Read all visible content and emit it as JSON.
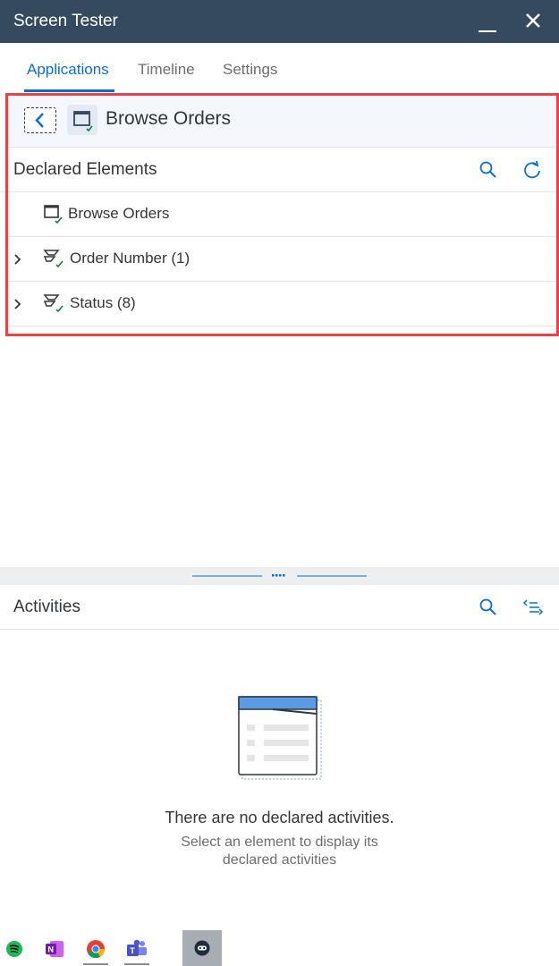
{
  "window": {
    "title": "Screen Tester"
  },
  "tabs": [
    {
      "label": "Applications",
      "active": true
    },
    {
      "label": "Timeline",
      "active": false
    },
    {
      "label": "Settings",
      "active": false
    }
  ],
  "screen": {
    "title": "Browse Orders"
  },
  "declared": {
    "header": "Declared Elements",
    "items": [
      {
        "label": "Browse Orders",
        "icon": "window-check-icon",
        "expandable": false
      },
      {
        "label": "Order Number (1)",
        "icon": "element-check-icon",
        "expandable": true
      },
      {
        "label": "Status (8)",
        "icon": "element-check-icon",
        "expandable": true
      }
    ]
  },
  "activities": {
    "header": "Activities",
    "empty_title": "There are no declared activities.",
    "empty_line1": "Select an element to display its",
    "empty_line2": "declared activities"
  },
  "taskbar": {
    "apps": [
      "spotify-icon",
      "onenote-icon",
      "chrome-icon",
      "teams-icon",
      "agent-icon"
    ]
  },
  "colors": {
    "header_bg": "#354a5f",
    "accent": "#0a6ed1",
    "highlight_border": "#e8434a",
    "check": "#107e3e"
  }
}
